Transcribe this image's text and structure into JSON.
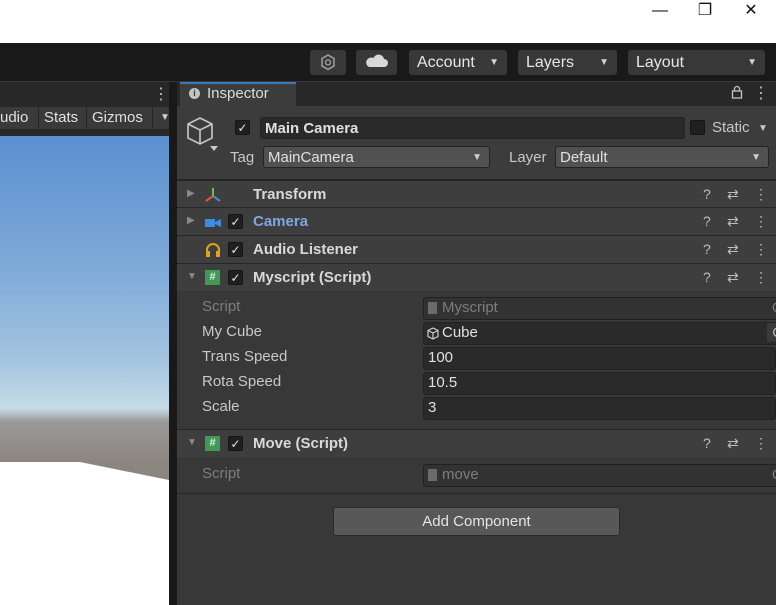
{
  "window": {
    "minimize_glyph": "—",
    "restore_glyph": "❐",
    "close_glyph": "✕"
  },
  "toolbar": {
    "account_label": "Account",
    "layers_label": "Layers",
    "layout_label": "Layout",
    "dropdown_glyph": "▼"
  },
  "scene": {
    "tabs": [
      "udio",
      "Stats",
      "Gizmos"
    ],
    "menu_glyph": "⋮"
  },
  "inspector": {
    "tab_label": "Inspector",
    "object": {
      "name": "Main Camera",
      "static_label": "Static",
      "tag_label": "Tag",
      "tag_value": "MainCamera",
      "layer_label": "Layer",
      "layer_value": "Default"
    },
    "components": [
      {
        "title": "Transform"
      },
      {
        "title": "Camera"
      },
      {
        "title": "Audio Listener"
      },
      {
        "title": "Myscript (Script)",
        "props": [
          {
            "label": "Script",
            "value": "Myscript"
          },
          {
            "label": "My Cube",
            "value": "Cube"
          },
          {
            "label": "Trans Speed",
            "value": "100"
          },
          {
            "label": "Rota Speed",
            "value": "10.5"
          },
          {
            "label": "Scale",
            "value": "3"
          }
        ]
      },
      {
        "title": "Move (Script)",
        "props": [
          {
            "label": "Script",
            "value": "move"
          }
        ]
      }
    ],
    "add_component_label": "Add Component"
  },
  "colors": {
    "accent_blue": "#3a79bb",
    "camera_title": "#7ea6e0",
    "listener_icon": "#e0a31a",
    "script_icon": "#3f9a56"
  }
}
